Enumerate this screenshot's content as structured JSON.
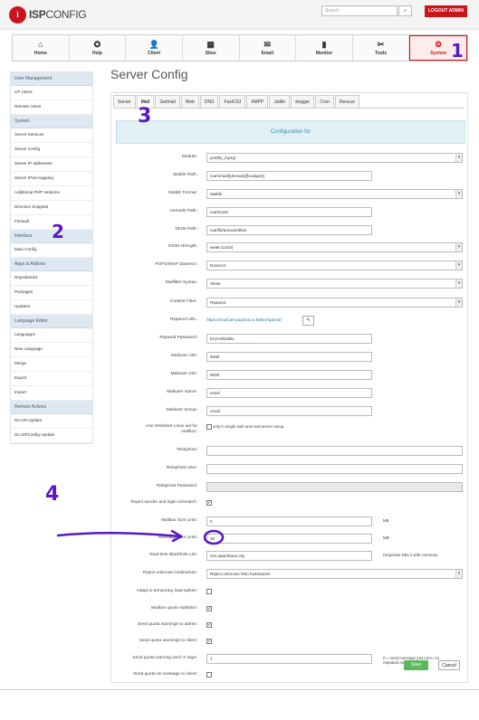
{
  "app": {
    "logo_badge": "i",
    "logo_bold": "ISP",
    "logo_light": "CONFIG"
  },
  "header": {
    "search_placeholder": "Search",
    "search_icon": "search-icon",
    "logout_label": "LOGOUT ADMIN"
  },
  "nav": [
    {
      "label": "Home",
      "icon": "⌂"
    },
    {
      "label": "Help",
      "icon": "✪"
    },
    {
      "label": "Client",
      "icon": "👤"
    },
    {
      "label": "Sites",
      "icon": "▦"
    },
    {
      "label": "Email",
      "icon": "✉"
    },
    {
      "label": "Monitor",
      "icon": "▮"
    },
    {
      "label": "Tools",
      "icon": "✂"
    },
    {
      "label": "System",
      "icon": "⚙"
    }
  ],
  "sidebar": {
    "groups": [
      {
        "title": "User Management",
        "items": [
          "CP Users",
          "Remote Users"
        ]
      },
      {
        "title": "System",
        "items": [
          "Server Services",
          "Server Config",
          "Server IP addresses",
          "Server IPv6 mapping",
          "Additional PHP Versions",
          "Directive Snippets",
          "Firewall"
        ]
      },
      {
        "title": "Interface",
        "items": [
          "Main Config"
        ]
      },
      {
        "title": "Apps & Addons",
        "items": [
          "Repositories",
          "Packages",
          "Updates"
        ]
      },
      {
        "title": "Language Editor",
        "items": [
          "Languages",
          "New Language",
          "Merge",
          "Export",
          "Import"
        ]
      },
      {
        "title": "Remote Actions",
        "items": [
          "Do OS-Update",
          "Do ISPConfig-Update"
        ]
      }
    ]
  },
  "page": {
    "title": "Server Config",
    "config_box": "Configuration for"
  },
  "tabs": [
    "Server",
    "Mail",
    "Getmail",
    "Web",
    "DNS",
    "FastCGI",
    "XMPP",
    "Jailkit",
    "vlogger",
    "Cron",
    "Rescue"
  ],
  "form": {
    "module_label": "Module:",
    "module_value": "postfix_mysql",
    "maildir_path_label": "Maildir Path:",
    "maildir_path_value": "/var/vmail/[domain]/[localpart]",
    "maildir_format_label": "Maildir Format:",
    "maildir_format_value": "Maildir",
    "homedir_path_label": "Homedir Path:",
    "homedir_path_value": "/var/vmail",
    "dkim_path_label": "DKIM Path:",
    "dkim_path_value": "/var/lib/amavis/dkim",
    "dkim_strength_label": "DKIM strength:",
    "dkim_strength_value": "weak (1024)",
    "pop3_label": "POP3/IMAP Daemon:",
    "pop3_value": "Dovecot",
    "mailfilter_label": "Mailfilter Syntax:",
    "mailfilter_value": "Sieve",
    "content_filter_label": "Content Filter:",
    "content_filter_value": "Rspamd",
    "rspamd_url_label": "Rspamd URL:",
    "rspamd_url_value": "https://vmail.jerryapizza.ru:8081/rspamd/",
    "rspamd_pw_label": "Rspamd Password:",
    "rspamd_pw_value": "bAzAdNUBtL",
    "mailuser_uid_label": "Mailuser UID:",
    "mailuser_uid_value": "5000",
    "mailuser_gid_label": "Mailuser GID:",
    "mailuser_gid_value": "5000",
    "mailuser_name_label": "Mailuser Name:",
    "mailuser_name_value": "vmail",
    "mailuser_group_label": "Mailuser Group:",
    "mailuser_group_value": "vmail",
    "webalias_label": "Use Websites Linux uid for mailbox:",
    "webalias_after": "only in single web and mail-server-setup",
    "relayhost_label": "Relayhost:",
    "relayhost_user_label": "Relayhost User:",
    "relayhost_pw_label": "Relayhost Password:",
    "reject_sender_label": "Reject sender and login mismatch:",
    "mailbox_size_label": "Mailbox Size Limit:",
    "mailbox_size_value": "0",
    "mailbox_size_unit": "MB",
    "message_size_label": "Message Size Limit:",
    "message_size_value": "30",
    "message_size_unit": "MB",
    "rbl_label": "Real-time Blackhole List:",
    "rbl_value": "zen.spamhaus.org",
    "rbl_after": "(Separate RBL's with commas)",
    "reject_unknown_label": "Reject unknown hostnames:",
    "reject_unknown_value": "Reject unknown helo hostnames",
    "adapt_label": "Adapt to temporary load spikes:",
    "quota_stats_label": "Mailbox quota statistics:",
    "quota_admin_label": "Send quota warnings to admin:",
    "quota_client_label": "Send quota warnings to client:",
    "quota_days_label": "Send quota warning each X days:",
    "quota_days_value": "7",
    "quota_days_after": "0 = send message just once, no repeated messages",
    "quota_ok_label": "Send quota ok message to client:"
  },
  "buttons": {
    "save": "Save",
    "cancel": "Cancel"
  },
  "annotations": {
    "one": "1",
    "two": "2",
    "three": "3",
    "four": "4"
  },
  "colors": {
    "accent": "#c8151b",
    "annotation": "#5a17c7",
    "save": "#5cb85c"
  }
}
